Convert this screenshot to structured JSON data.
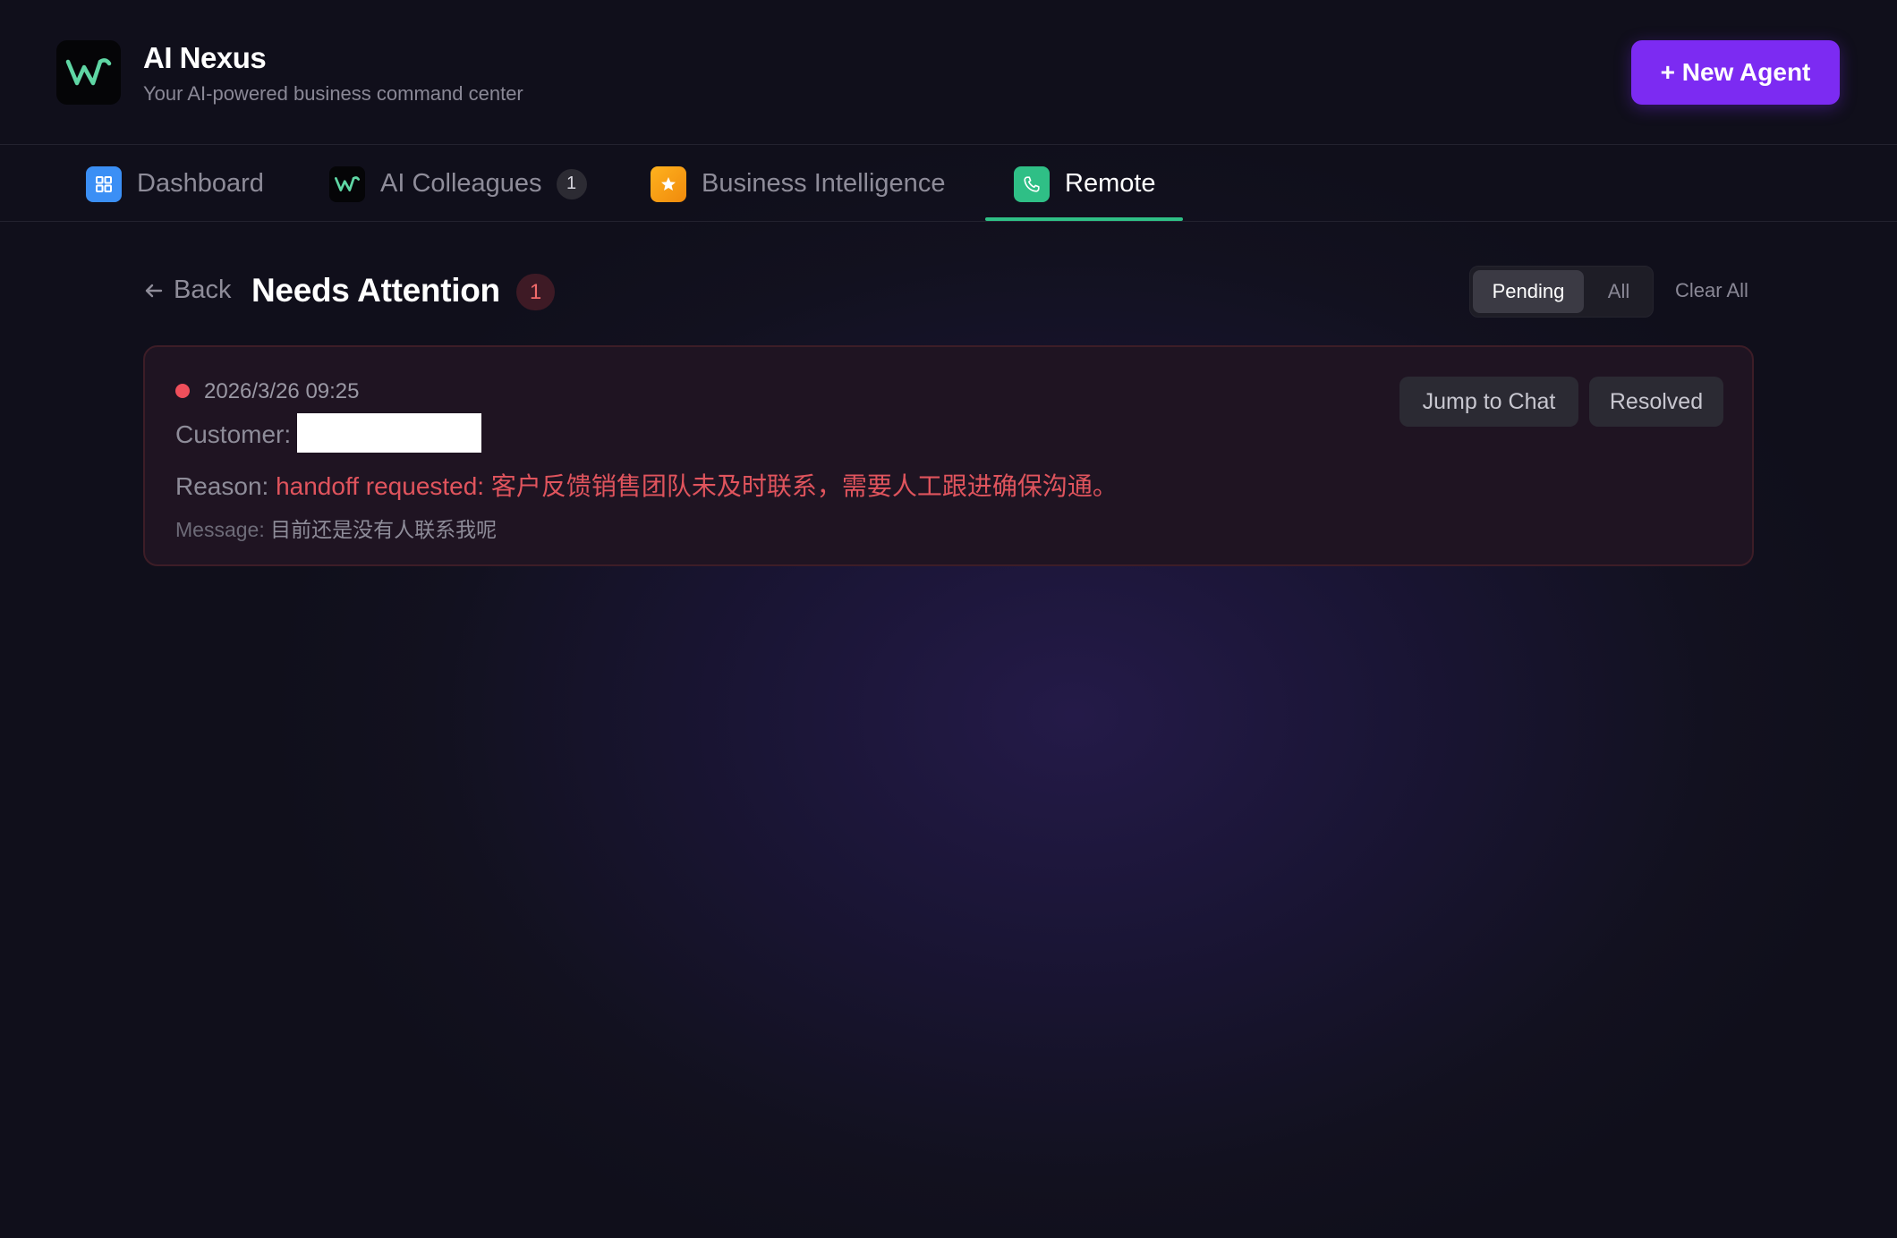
{
  "app": {
    "title": "AI Nexus",
    "subtitle": "Your AI-powered business command center",
    "new_agent_label": "+ New Agent"
  },
  "tabs": [
    {
      "label": "Dashboard",
      "icon": "dashboard-icon",
      "color": "#3b8ff5"
    },
    {
      "label": "AI Colleagues",
      "icon": "wave-logo-icon",
      "badge": "1"
    },
    {
      "label": "Business Intelligence",
      "icon": "star-icon",
      "color": "#f5a014"
    },
    {
      "label": "Remote",
      "icon": "phone-icon",
      "color": "#2fbf86",
      "active": true
    }
  ],
  "section": {
    "back_label": "Back",
    "title": "Needs Attention",
    "count": "1",
    "filters": [
      {
        "label": "Pending",
        "active": true
      },
      {
        "label": "All",
        "active": false
      }
    ],
    "clear_all_label": "Clear All"
  },
  "alert": {
    "timestamp": "2026/3/26 09:25",
    "customer_label": "Customer:",
    "reason_label": "Reason:",
    "reason_text": "handoff requested: 客户反馈销售团队未及时联系，需要人工跟进确保沟通。",
    "message_label": "Message:",
    "message_text": "目前还是没有人联系我呢",
    "jump_label": "Jump to Chat",
    "resolved_label": "Resolved"
  },
  "colors": {
    "accent": "#7c2bf2",
    "active_tab": "#2fbf86",
    "alert": "#ef4f5b"
  }
}
